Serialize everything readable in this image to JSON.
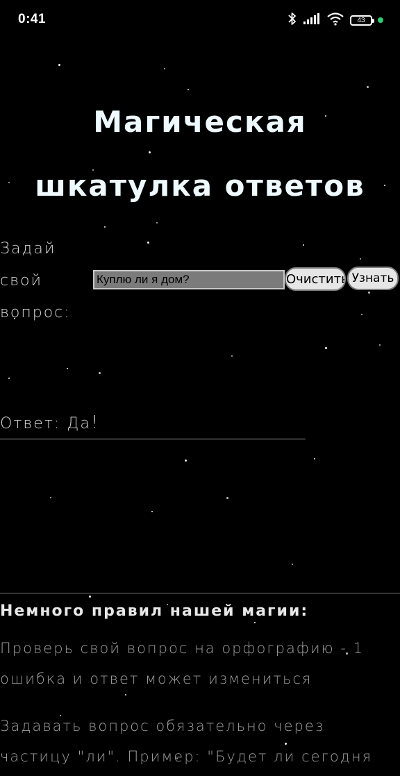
{
  "status_bar": {
    "time": "0:41",
    "battery": "43",
    "icons": [
      "bluetooth-icon",
      "signal-icon",
      "wifi-icon",
      "battery-icon",
      "camera-indicator-dot"
    ],
    "indicator_color": "#2ecc71"
  },
  "page": {
    "title": "Магическая шкатулка ответов",
    "question_label": "Задай свой вопрос:",
    "question_value": "Куплю ли я дом?",
    "clear_button": "Очистить",
    "ask_button": "Узнать",
    "answer_prefix": "Ответ: Да",
    "answer_suffix": "!"
  },
  "rules": {
    "title": "Немного правил нашей магии:",
    "items": [
      "Проверь свой вопрос на орфографию - 1 ошибка и ответ может измениться",
      "Задавать вопрос обязательно через частицу \"ли\". Пример: \"Будет ли сегодня"
    ]
  },
  "colors": {
    "background": "#000000",
    "title": "#eefaff",
    "text": "#d8d8d8",
    "muted": "#9e9e9e"
  }
}
